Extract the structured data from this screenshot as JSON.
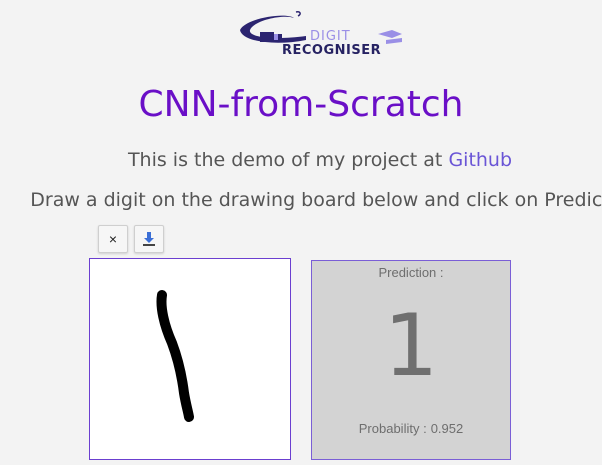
{
  "logo": {
    "top_text": "DIGIT",
    "bottom_text": "RECOGNISER",
    "colors": {
      "swoosh": "#2b2470",
      "accent": "#9a8fe6"
    }
  },
  "title": "CNN-from-Scratch",
  "intro": {
    "prefix": "This is the demo of my project at ",
    "link_text": "Github"
  },
  "instructions": "Draw a digit on the drawing board below and click on Predict",
  "toolbar": {
    "clear_label": "×",
    "save_icon": "download-icon"
  },
  "board": {
    "stroke_color": "#000000",
    "drawn_digit": "1"
  },
  "prediction": {
    "label": "Prediction :",
    "digit": "1",
    "probability_label": "Probability :",
    "probability_value": "0.952"
  },
  "colors": {
    "title": "#6a0fc7",
    "link": "#6a55d6",
    "board_border": "#6b3fd0",
    "pred_bg": "#d3d3d3"
  }
}
